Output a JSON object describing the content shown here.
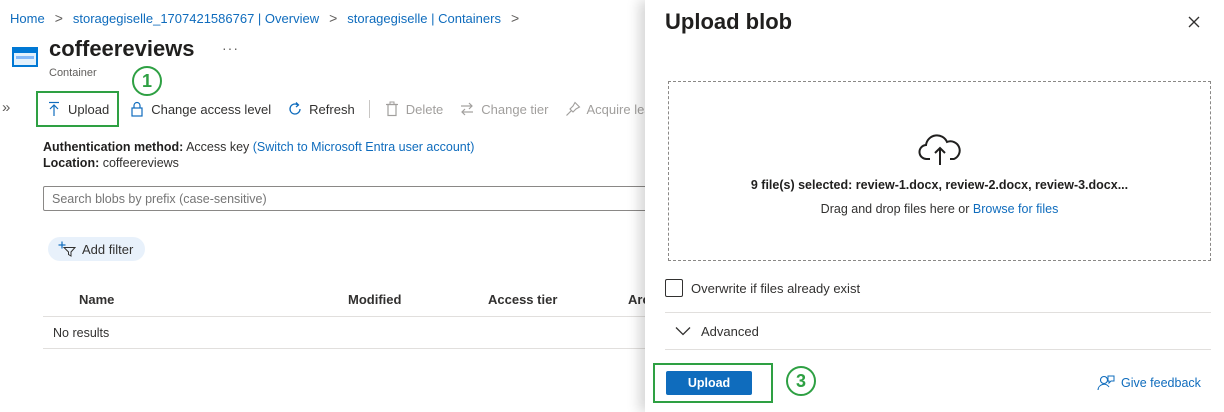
{
  "breadcrumb": {
    "items": [
      "Home",
      "storagegiselle_1707421586767 | Overview",
      "storagegiselle | Containers"
    ],
    "separator": ">"
  },
  "header": {
    "title": "coffeereviews",
    "subtitle": "Container",
    "more": "···"
  },
  "annotations": {
    "step1": "1",
    "step3": "3"
  },
  "toolbar": {
    "expand": "»",
    "upload": "Upload",
    "change_access": "Change access level",
    "refresh": "Refresh",
    "delete": "Delete",
    "change_tier": "Change tier",
    "acquire_lease": "Acquire lease"
  },
  "info": {
    "auth_label": "Authentication method:",
    "auth_value": "Access key",
    "auth_link": "(Switch to Microsoft Entra user account)",
    "location_label": "Location:",
    "location_value": "coffeereviews"
  },
  "search": {
    "placeholder": "Search blobs by prefix (case-sensitive)"
  },
  "filter": {
    "label": "Add filter"
  },
  "table": {
    "columns": [
      "Name",
      "Modified",
      "Access tier",
      "Archive status"
    ],
    "empty_text": "No results"
  },
  "panel": {
    "title": "Upload blob",
    "files_selected": "9 file(s) selected: review-1.docx, review-2.docx, review-3.docx...",
    "drag_text": "Drag and drop files here",
    "or": "or",
    "browse": "Browse for files",
    "overwrite": "Overwrite if files already exist",
    "advanced": "Advanced",
    "upload_button": "Upload",
    "feedback": "Give feedback"
  },
  "colors": {
    "accent": "#0f6cbd",
    "highlight": "#2ea043"
  }
}
